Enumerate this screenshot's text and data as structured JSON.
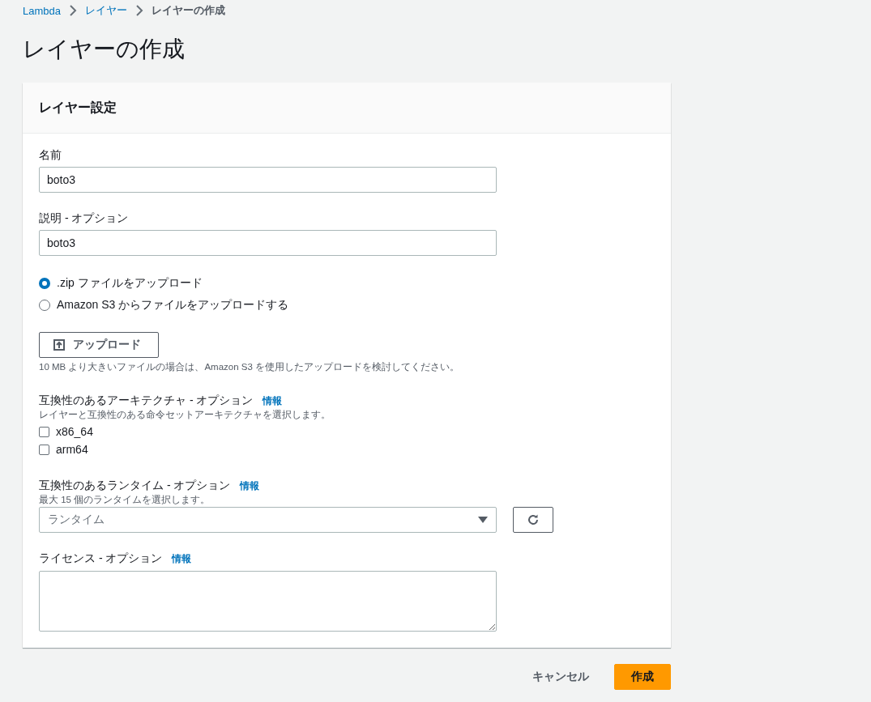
{
  "breadcrumb": [
    {
      "label": "Lambda",
      "kind": "link"
    },
    {
      "label": "レイヤー",
      "kind": "link"
    },
    {
      "label": "レイヤーの作成",
      "kind": "current"
    }
  ],
  "page_title": "レイヤーの作成",
  "panel": {
    "title": "レイヤー設定",
    "name_field": {
      "label": "名前",
      "value": "boto3"
    },
    "description_field": {
      "label": "説明 - オプション",
      "value": "boto3"
    },
    "upload_source": [
      {
        "label": ".zip ファイルをアップロード",
        "selected": true
      },
      {
        "label": "Amazon S3 からファイルをアップロードする",
        "selected": false
      }
    ],
    "upload_button": {
      "label": "アップロード"
    },
    "upload_hint": "10 MB より大きいファイルの場合は、Amazon S3 を使用したアップロードを検討してください。",
    "architectures": {
      "label": "互換性のあるアーキテクチャ - オプション",
      "info": "情報",
      "hint": "レイヤーと互換性のある命令セットアーキテクチャを選択します。",
      "options": [
        {
          "label": "x86_64",
          "checked": false
        },
        {
          "label": "arm64",
          "checked": false
        }
      ]
    },
    "runtimes": {
      "label": "互換性のあるランタイム - オプション",
      "info": "情報",
      "hint": "最大 15 個のランタイムを選択します。",
      "placeholder": "ランタイム"
    },
    "license": {
      "label": "ライセンス - オプション",
      "info": "情報"
    }
  },
  "actions": {
    "cancel": "キャンセル",
    "create": "作成"
  }
}
